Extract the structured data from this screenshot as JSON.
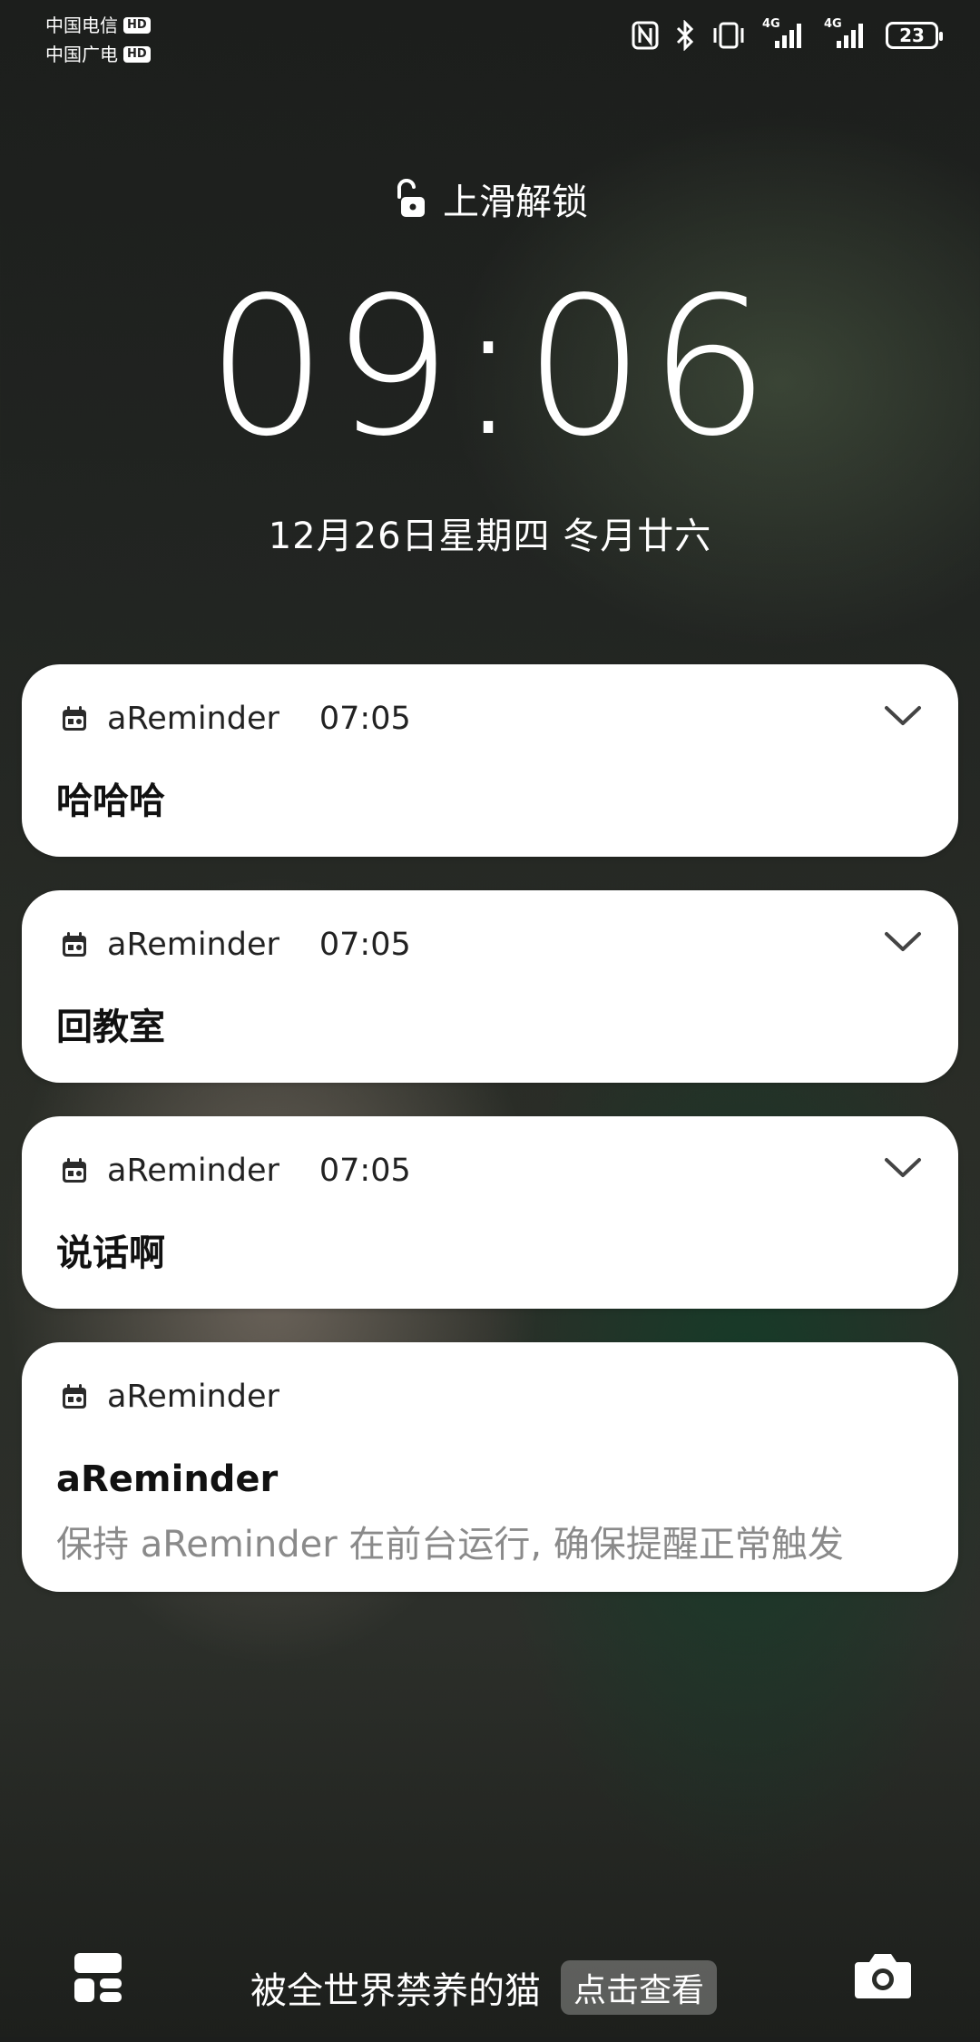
{
  "status_bar": {
    "carrier1": "中国电信",
    "carrier2": "中国广电",
    "hd_badge": "HD",
    "network1": "4G",
    "network2": "4G",
    "battery": "23"
  },
  "lock": {
    "unlock_text": "上滑解锁",
    "time": "09:06",
    "date": "12月26日星期四 冬月廿六"
  },
  "notifications": [
    {
      "app": "aReminder",
      "time": "07:05",
      "title": "哈哈哈"
    },
    {
      "app": "aReminder",
      "time": "07:05",
      "title": "回教室"
    },
    {
      "app": "aReminder",
      "time": "07:05",
      "title": "说话啊"
    },
    {
      "app": "aReminder",
      "time": "",
      "title": "aReminder",
      "body": "保持 aReminder 在前台运行, 确保提醒正常触发"
    }
  ],
  "bottom": {
    "caption": "被全世界禁养的猫",
    "view_button": "点击查看"
  },
  "icons": {
    "lock": "unlock-icon",
    "calendar": "calendar-icon",
    "widget": "widget-icon",
    "camera": "camera-icon"
  }
}
